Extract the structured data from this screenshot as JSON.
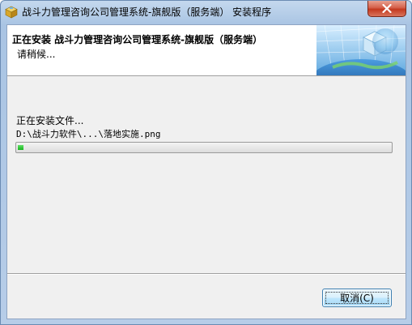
{
  "window": {
    "title": "战斗力管理咨询公司管理系统-旗舰版（服务端） 安装程序"
  },
  "header": {
    "title": "正在安装 战斗力管理咨询公司管理系统-旗舰版（服务端）",
    "subtitle": "请稍候..."
  },
  "progress": {
    "status": "正在安装文件...",
    "current_file": "D:\\战斗力软件\\...\\落地实施.png",
    "fraction": 0.015
  },
  "buttons": {
    "cancel": "取消(C)"
  },
  "colors": {
    "progress_fill": "#19b21f",
    "close_button": "#c3391f",
    "title_bar": "#a9c4e3"
  },
  "icons": {
    "app": "installer-box-icon",
    "close": "close-icon"
  }
}
